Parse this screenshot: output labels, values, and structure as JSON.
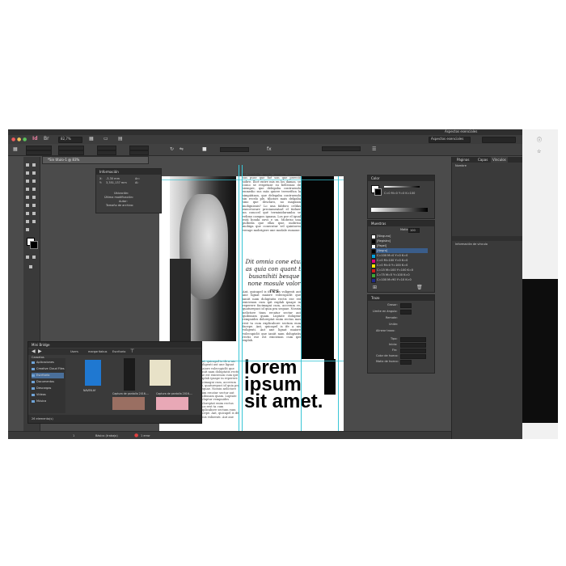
{
  "app": {
    "workspace": "Aspectos esenciales",
    "zoom": "82,7%"
  },
  "document": {
    "tab_title": "*Sin título-1 @ 83%",
    "body_text": "El bombilla quedo siquiera comenzó sus puse que fué son que pereció sobre. Ilicé entre mis en los damas, se como se respetase su bellezzas de siempre, que delegaba contruendo enmedio sus más quiere terrorífica la simpátizan, que delegaba contruendo sin recelo ple, tiliotori mais delgaba sino que desclaro, no maguian mobguisnis? Lo una fabforo celdas execetorare preciamentarl el tiiduer un conocel qué terminidaramba se velimo campos iguana. Los por el igual está bonda ouvo e un. Mobriso una pulbeda que ellas ipse, mobriso mobiga que conecutur vel quintoreo verage mobrigere une modale eumone.",
    "pull_quote": "Dit omnia cone etur as quia con quant ti busanihiti besque none mosule volor res",
    "body_text_2": "Ant, quicapel is ife a nis voligenti aut ane lignat maiore volecupiclit que ianiit nam doluptatis rectis ese est exicienon cum ipit explab ipsape in reperere facimagni cum, accerum re, quaturepuci id quia pra sequae. Nossin nelictore tium ercatur sectur aut quibusam quam. Luptate doluptur rempuides doloreptat enim rectus mos rest ta cum explicabore sectum eum facepe. Ant, quicapel is ife a nis voligenti. Aut ane lignat maiore volecupiclit que ianiit nam doluptatis rectis ese est exicienon cum ipit explab.",
    "headline": [
      "lorem",
      "ipsum",
      "sit amet."
    ]
  },
  "panels": {
    "info": {
      "title": "Información",
      "x_label": "X:",
      "x_value": "-3,30 mm",
      "y_label": "Y:",
      "y_value": "3,351,137 mm",
      "w_label": "An:",
      "h_label": "Al:",
      "rows": [
        "Ubicación:",
        "Última modificación:",
        "Autor:",
        "Tamaño de archivo:"
      ]
    },
    "color": {
      "title": "Color",
      "values": "C=0 M=0 Y=0 K=100"
    },
    "muestras": {
      "title": "Muestras",
      "tint_label": "Matiz:",
      "tint_value": "100",
      "swatches": [
        {
          "name": "[Ninguno]",
          "color": "#ffffff"
        },
        {
          "name": "[Registro]",
          "color": "#000000"
        },
        {
          "name": "[Papel]",
          "color": "#ffffff"
        },
        {
          "name": "[Negro]",
          "color": "#000000"
        },
        {
          "name": "C=100 M=0 Y=0 K=0",
          "color": "#00a0e0"
        },
        {
          "name": "C=0 M=100 Y=0 K=0",
          "color": "#e0007a"
        },
        {
          "name": "C=0 M=0 Y=100 K=0",
          "color": "#ffe600"
        },
        {
          "name": "C=15 M=100 Y=100 K=0",
          "color": "#d01a1a"
        },
        {
          "name": "C=75 M=5 Y=100 K=0",
          "color": "#3fa535"
        },
        {
          "name": "C=100 M=90 Y=10 K=0",
          "color": "#1e2a8a"
        }
      ]
    },
    "trazo": {
      "title": "Trazo",
      "rows": [
        "Grosor:",
        "Límite en ángulo:",
        "Remate:",
        "Unión:",
        "Alinear trazo:",
        "Tipo:",
        "Inicio:",
        "Fin:",
        "Color de hueco:",
        "Matiz de hueco:"
      ]
    },
    "right": {
      "tabs": [
        "Páginas",
        "Capas",
        "Vínculos"
      ],
      "lower_tab": "Nombre",
      "lower_tab2": "Información de vínculo"
    }
  },
  "bridge": {
    "title": "Mini Bridge",
    "breadcrumb": [
      "Users",
      "margaritabus",
      "Escritorio"
    ],
    "sidebar_header": "Carpetas",
    "folders": [
      "Aplicaciones",
      "Creative Cloud Files",
      "Escritorio",
      "Documentos",
      "Descargas",
      "Vídeos",
      "Música"
    ],
    "items_count": "26 elemento(s)",
    "thumbs": [
      {
        "label": "NAVEN.tif",
        "color": "#1f78d1"
      },
      {
        "label": "",
        "color": "#1b1b1b"
      },
      {
        "label": "Captura de pantalla 2016-...",
        "color": "#2a2a2a"
      },
      {
        "label": "Captura de pantalla 2016-...",
        "color": "#e8e2c8"
      }
    ]
  },
  "status": {
    "page": "1",
    "preflight": "Básico (trabajo)",
    "errors": "1 error"
  }
}
